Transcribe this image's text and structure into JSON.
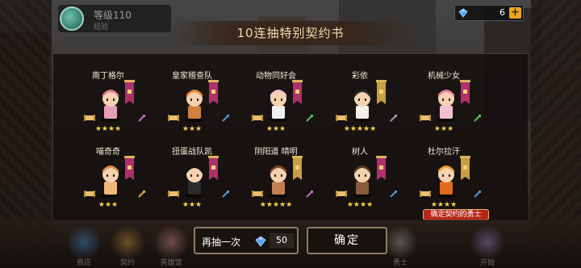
{
  "player": {
    "name": "等级110",
    "subtitle": "经验"
  },
  "currency": {
    "value": "6",
    "plus": "+"
  },
  "title": "10连抽特别契约书",
  "cards": [
    {
      "name": "南丁格尔",
      "stars": "★★★★",
      "body": "#e8a0b8",
      "hair": "#e07a9a",
      "banner": "#b0306a",
      "weapon": "#c070c0"
    },
    {
      "name": "皇家稽查队",
      "stars": "★★★",
      "body": "#d08040",
      "hair": "#e0882a",
      "banner": "#b0306a",
      "weapon": "#4a9ad0"
    },
    {
      "name": "动物同好会",
      "stars": "★★★",
      "body": "#f0f0f0",
      "hair": "#f4c0c8",
      "banner": "#b0306a",
      "weapon": "#5ac060"
    },
    {
      "name": "彩依",
      "stars": "★★★★★",
      "body": "#f0f0e8",
      "hair": "#2a2a2a",
      "banner": "#c8a040",
      "weapon": "#a0a0b0"
    },
    {
      "name": "机械少女",
      "stars": "★★★",
      "body": "#f2c0d0",
      "hair": "#e880a8",
      "banner": "#b0306a",
      "weapon": "#5ac060"
    },
    {
      "name": "喵奇奇",
      "stars": "★★★",
      "body": "#f0b878",
      "hair": "#d8904a",
      "banner": "#b0306a",
      "weapon": "#e0b040"
    },
    {
      "name": "扭蛋战队凯",
      "stars": "★★★",
      "body": "#2a2a2a",
      "hair": "#111111",
      "banner": "#b0306a",
      "weapon": "#4a9ad0"
    },
    {
      "name": "阴阳道 晴明",
      "stars": "★★★★★",
      "body": "#c08050",
      "hair": "#7a4a2a",
      "banner": "#c8a040",
      "weapon": "#c070c0"
    },
    {
      "name": "树人",
      "stars": "★★★★",
      "body": "#8a5a3a",
      "hair": "#5a3a20",
      "banner": "#b0306a",
      "weapon": "#4a9ad0"
    },
    {
      "name": "杜尔拉汗",
      "stars": "★★★★",
      "body": "#e06a20",
      "hair": "#f0a030",
      "banner": "#c8a040",
      "weapon": "#4a9ad0"
    }
  ],
  "featured_tag": "确定契约的勇士",
  "again_button": {
    "label": "再抽一次",
    "cost": "50"
  },
  "confirm_button": {
    "label": "确定"
  },
  "nav": [
    {
      "label": "商店"
    },
    {
      "label": "契约"
    },
    {
      "label": "英雄馆"
    },
    {
      "label": "勇士"
    },
    {
      "label": "开始"
    }
  ],
  "colors": {
    "gem": "#4aa6ff",
    "gold": "#e9a623",
    "star": "#f6d24a",
    "tag": "#b8261a"
  }
}
